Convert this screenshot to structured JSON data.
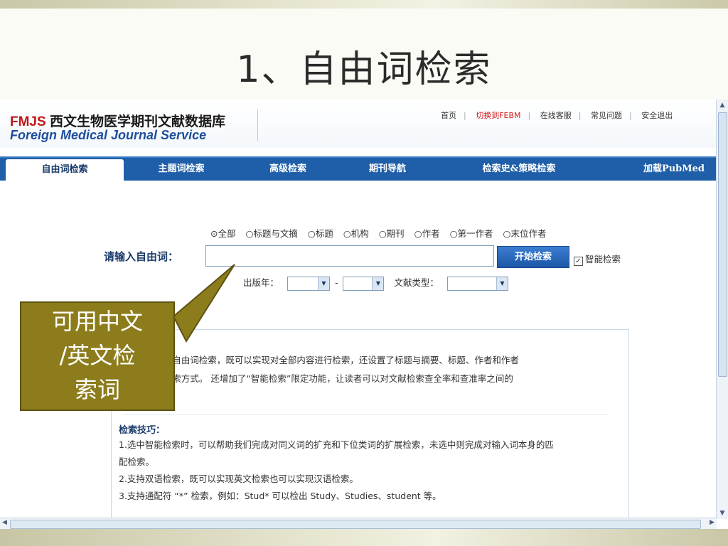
{
  "slide": {
    "title": "1、自由词检索"
  },
  "header": {
    "logo_prefix": "FMJS",
    "logo_cn": " 西文生物医学期刊文献数据库",
    "logo_en": "Foreign Medical Journal Service",
    "links": [
      "首页",
      "切换到FEBM",
      "在线客服",
      "常见问题",
      "安全退出"
    ]
  },
  "nav": {
    "tabs": [
      "自由词检索",
      "主题词检索",
      "高级检索",
      "期刊导航",
      "检索史&策略检索",
      "加载PubMed"
    ],
    "active": "自由词检索"
  },
  "search": {
    "radios": [
      "全部",
      "标题与文摘",
      "标题",
      "机构",
      "期刊",
      "作者",
      "第一作者",
      "末位作者"
    ],
    "selected_radio": "全部",
    "label": "请输入自由词：",
    "input_value": "",
    "button": "开始检索",
    "smart_label": "智能检索",
    "smart_checked": true,
    "year_label": "出版年：",
    "range_sep": "-",
    "doctype_label": "文献类型："
  },
  "info": {
    "intro_lines": [
      "b使用的自由词检索，既可以实现对全部内容进行检索，还设置了标题与摘要、标题、作者和作者",
      "b快捷检索方式。 还增加了“智能检索”限定功能，让读者可以对文献检索查全率和查准率之间的",
      "k。"
    ],
    "tips_title": "检索技巧：",
    "tips": [
      "1.选中智能检索时，可以帮助我们完成对同义词的扩充和下位类词的扩展检索，未选中则完成对输入词本身的匹",
      "配检索。",
      "2.支持双语检索，既可以实现英文检索也可以实现汉语检索。",
      "3.支持通配符 “*” 检索，例如：Stud* 可以检出 Study、Studies、student 等。"
    ]
  },
  "callout": {
    "lines": [
      "可用中文",
      "/英文检",
      "索词"
    ]
  },
  "colors": {
    "nav": "#1f5ea8",
    "callout": "#8c7c1c",
    "brand_red": "#c01818",
    "brand_blue": "#1d4d9c"
  }
}
